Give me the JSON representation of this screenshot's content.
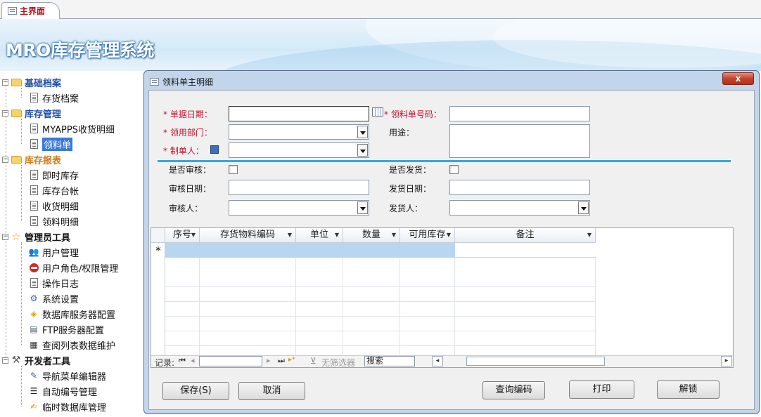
{
  "tab": {
    "label": "主界面"
  },
  "app": {
    "title": "MRO库存管理系统"
  },
  "nav": {
    "groups": [
      {
        "label": "基础档案",
        "items": [
          "存货档案"
        ]
      },
      {
        "label": "库存管理",
        "items": [
          "MYAPPS收货明细",
          "领料单"
        ]
      },
      {
        "label": "库存报表",
        "items": [
          "即时库存",
          "库存台帐",
          "收货明细",
          "领料明细"
        ]
      },
      {
        "label": "管理员工具",
        "items": [
          "用户管理",
          "用户角色/权限管理",
          "操作日志",
          "系统设置",
          "数据库服务器配置",
          "FTP服务器配置",
          "查阅列表数据维护"
        ]
      },
      {
        "label": "开发者工具",
        "items": [
          "导航菜单编辑器",
          "自动编号管理",
          "临时数据库管理"
        ]
      }
    ],
    "selected": "领料单"
  },
  "dialog": {
    "title": "领料单主明细",
    "close_label": "x",
    "fields": {
      "doc_date": {
        "label": "* 单据日期：",
        "value": ""
      },
      "doc_no": {
        "label": "* 领料单号码：",
        "value": ""
      },
      "dept": {
        "label": "* 领用部门：",
        "value": ""
      },
      "purpose": {
        "label": "用途：",
        "value": ""
      },
      "maker": {
        "label": "* 制单人：",
        "value": ""
      },
      "approved": {
        "label": "是否审核：",
        "checked": false
      },
      "shipped": {
        "label": "是否发货：",
        "checked": false
      },
      "approve_date": {
        "label": "审核日期：",
        "value": ""
      },
      "ship_date": {
        "label": "发货日期：",
        "value": ""
      },
      "approver": {
        "label": "审核人：",
        "value": ""
      },
      "shipper": {
        "label": "发货人：",
        "value": ""
      }
    },
    "grid": {
      "columns": [
        "序号",
        "存货物料编码",
        "单位",
        "数量",
        "可用库存",
        "备注"
      ],
      "new_row_marker": "*",
      "nav": {
        "record_label": "记录:",
        "first": "⏮",
        "prev": "◂",
        "next": "▸",
        "last": "⏭",
        "new": "▸*",
        "no_filter": "无筛选器",
        "search_label": "搜索"
      }
    },
    "buttons": {
      "save": "保存(S)",
      "cancel": "取消",
      "lookup": "查询编码",
      "print": "打印",
      "unlock": "解锁"
    }
  },
  "colors": {
    "required": "#c8102e",
    "accent": "#37a8db",
    "selection": "#3a78d8"
  }
}
